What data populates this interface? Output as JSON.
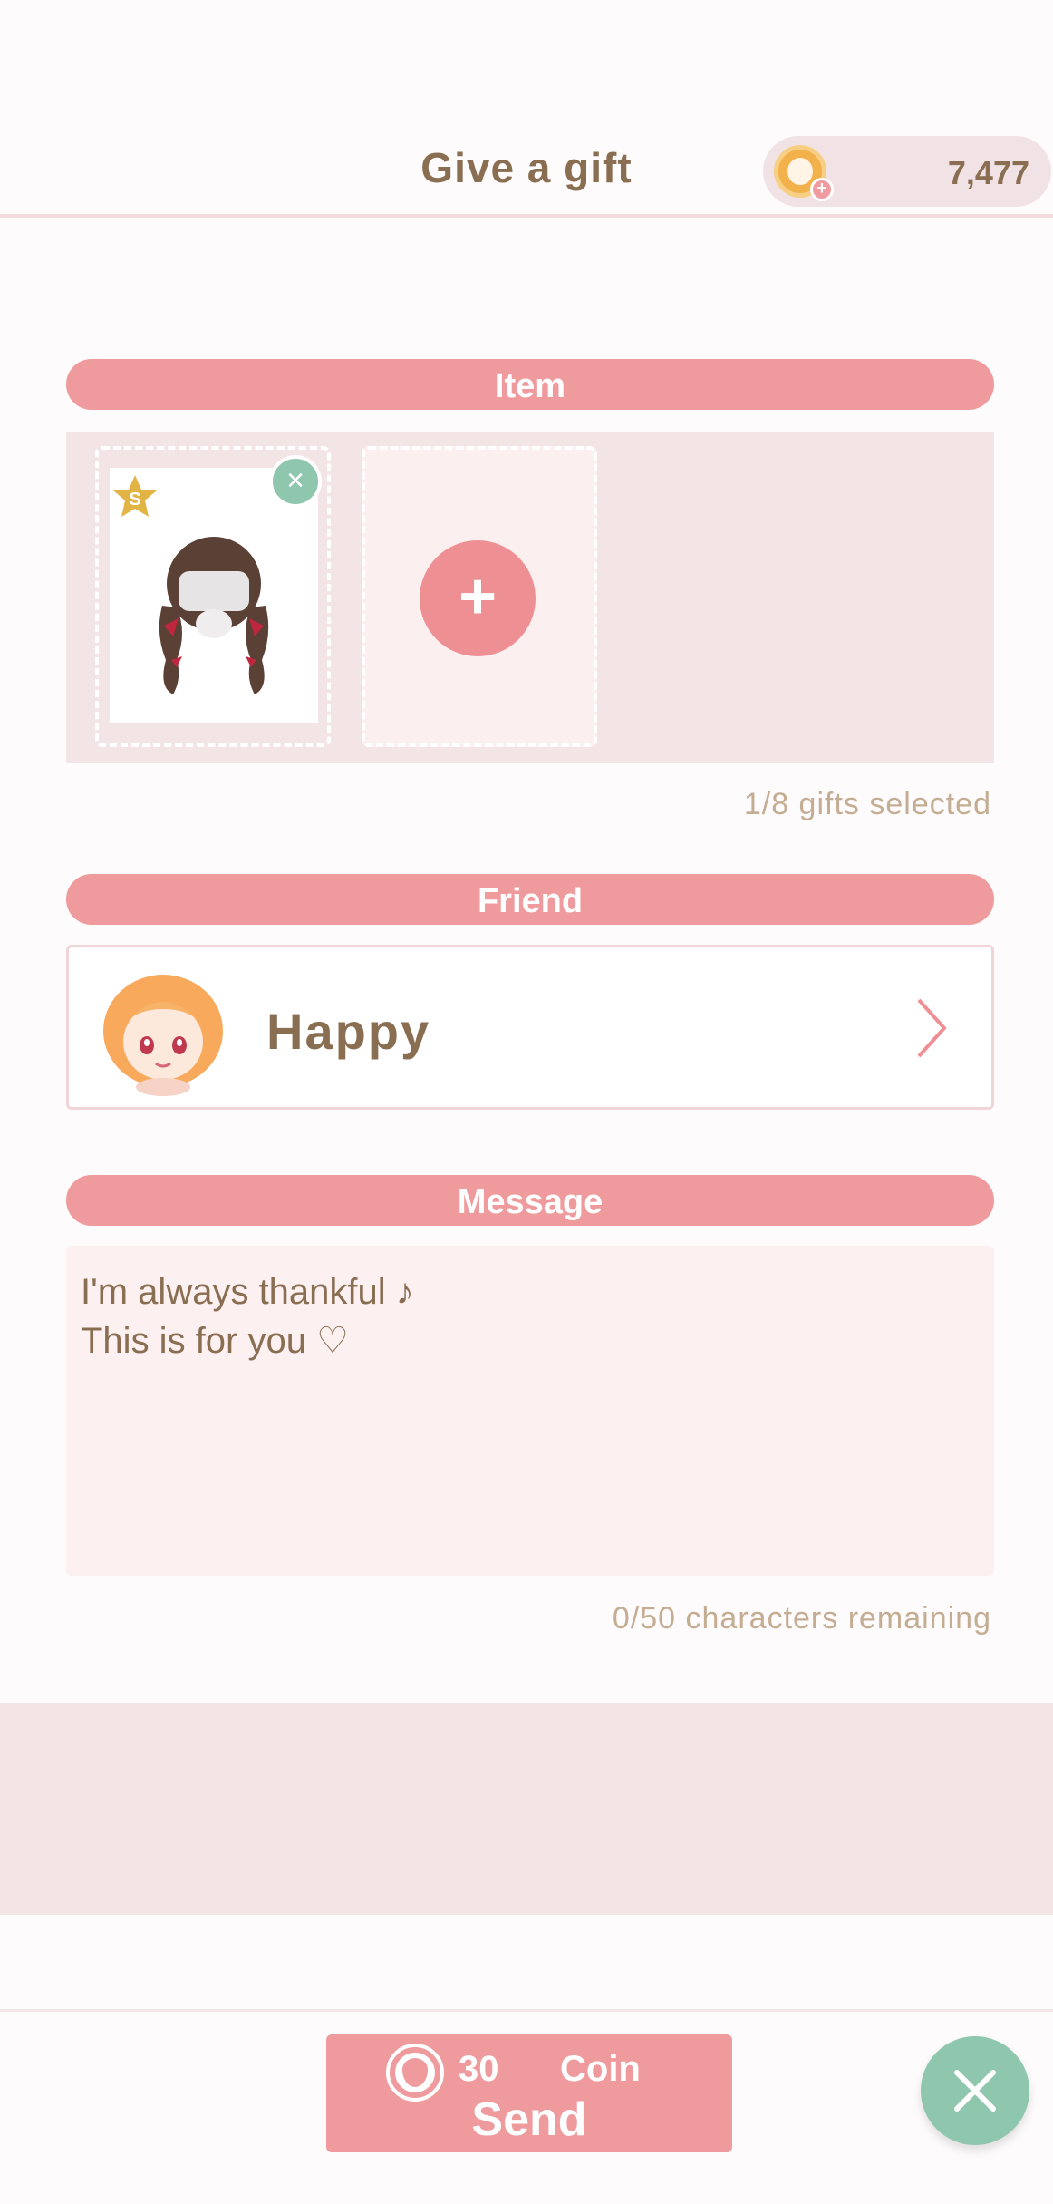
{
  "header": {
    "title": "Give a gift",
    "coin_balance": "7,477",
    "coin_icon": "coin-icon",
    "coin_add_icon": "plus-icon"
  },
  "sections": {
    "item_label": "Item",
    "friend_label": "Friend",
    "message_label": "Message"
  },
  "items": {
    "selected": [
      {
        "name": "twin-braid-hair",
        "rank": "S",
        "icon": "hair-icon"
      }
    ],
    "add_icon": "plus-icon",
    "add_symbol": "+",
    "remove_symbol": "×",
    "counter_text": "1/8  gifts selected"
  },
  "friend": {
    "name": "Happy",
    "avatar_icon": "avatar",
    "chevron_icon": "chevron-right-icon"
  },
  "message": {
    "lines": [
      "I'm always thankful ♪",
      "This is for you ♡"
    ],
    "counter_text": "0/50  characters remaining"
  },
  "send": {
    "cost": "30",
    "currency": "Coin",
    "label": "Send",
    "icon": "strawberry-coin-icon"
  },
  "colors": {
    "accent_pink": "#ef9a9d",
    "mint": "#8fc7ae",
    "text_brown": "#8a6e52",
    "panel_pink": "#f3e4e6"
  }
}
